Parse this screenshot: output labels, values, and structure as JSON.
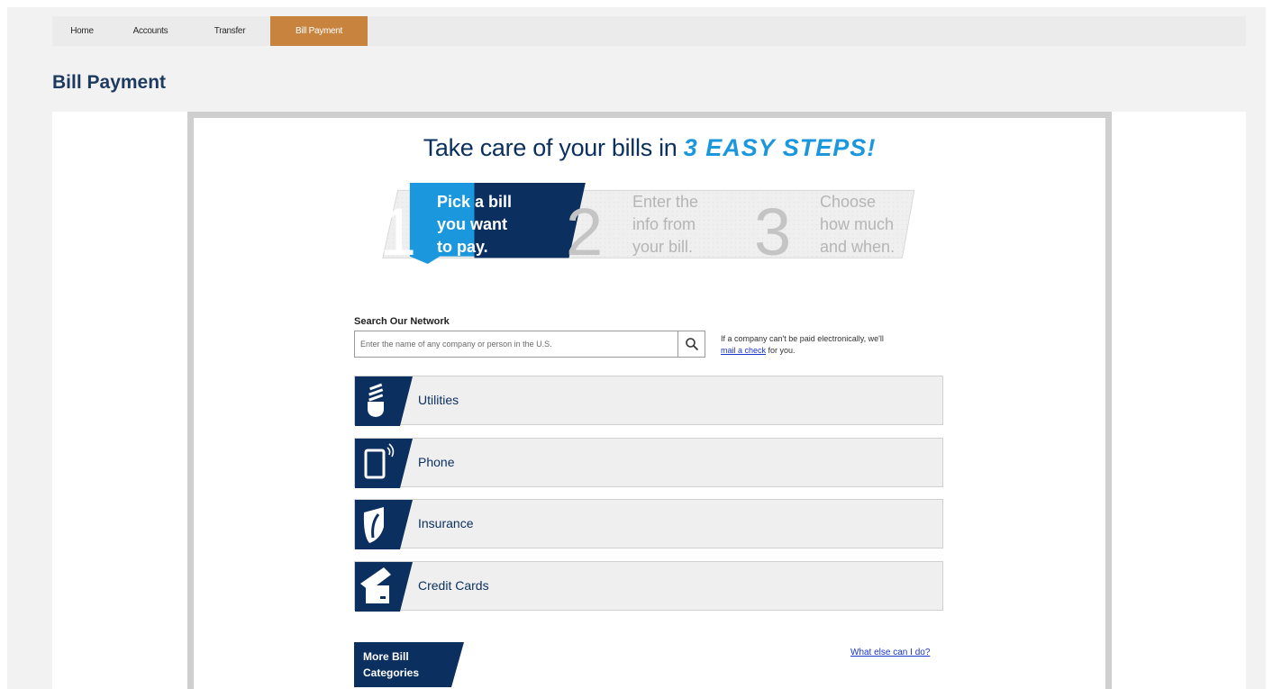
{
  "nav": {
    "items": [
      {
        "label": "Home"
      },
      {
        "label": "Accounts"
      },
      {
        "label": "Transfer"
      },
      {
        "label": "Bill Payment"
      }
    ],
    "active_index": 3
  },
  "page_title": "Bill Payment",
  "headline": {
    "text": "Take care of your bills in",
    "accent": "3 EASY STEPS!"
  },
  "steps": [
    {
      "number": "1",
      "lines": [
        "Pick a bill",
        "you want",
        "to pay."
      ]
    },
    {
      "number": "2",
      "lines": [
        "Enter the",
        "info from",
        "your bill."
      ]
    },
    {
      "number": "3",
      "lines": [
        "Choose",
        "how much",
        "and when."
      ]
    }
  ],
  "search": {
    "label": "Search Our Network",
    "placeholder": "Enter the name of any company or person in the U.S.",
    "value": "",
    "note_prefix": "If a company can't be paid electronically, we'll",
    "note_link": "mail a check",
    "note_suffix": "for you."
  },
  "categories": [
    {
      "label": "Utilities",
      "icon": "lightbulb-icon"
    },
    {
      "label": "Phone",
      "icon": "smartphone-icon"
    },
    {
      "label": "Insurance",
      "icon": "shield-leaf-icon"
    },
    {
      "label": "Credit Cards",
      "icon": "credit-card-icon"
    }
  ],
  "more_categories": {
    "line1": "More Bill",
    "line2": "Categories"
  },
  "what_else_link": "What else can I do?",
  "colors": {
    "navy": "#0b2f5e",
    "accent_blue": "#1b97dd",
    "active_tab": "#c8843e",
    "link": "#1a35c8"
  }
}
